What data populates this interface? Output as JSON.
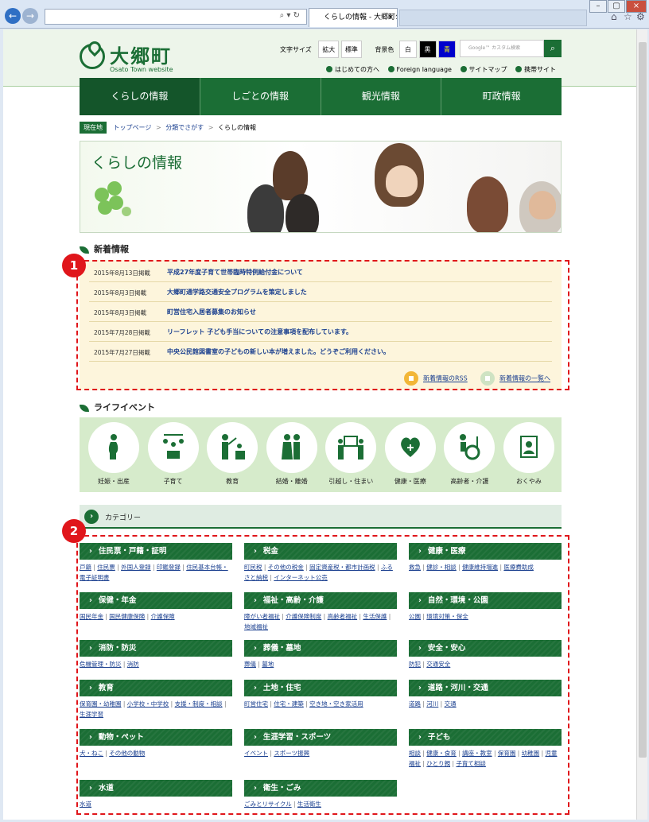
{
  "browser": {
    "tab_title": "くらしの情報 - 大郷町公...",
    "tab_close": "×",
    "back_icon": "←",
    "forward_icon": "→",
    "window_controls": [
      "–",
      "▢",
      "×"
    ]
  },
  "header": {
    "logo_title": "大郷町",
    "logo_subtitle": "Osato Town website",
    "font_size_label": "文字サイズ",
    "font_size_buttons": [
      "拡大",
      "標準"
    ],
    "bg_color_label": "背景色",
    "bg_color_buttons": [
      {
        "label": "白",
        "bg": "#ffffff",
        "fg": "#222222"
      },
      {
        "label": "黒",
        "bg": "#000000",
        "fg": "#ffffff"
      },
      {
        "label": "青",
        "bg": "#0000cc",
        "fg": "#ffff00"
      }
    ],
    "search_placeholder": "Google™ カスタム検索",
    "links": [
      "はじめての方へ",
      "Foreign language",
      "サイトマップ",
      "携帯サイト"
    ]
  },
  "global_nav": [
    "くらしの情報",
    "しごとの情報",
    "観光情報",
    "町政情報"
  ],
  "breadcrumb": {
    "tag": "現在地",
    "items": [
      "トップページ",
      "分類でさがす",
      "くらしの情報"
    ],
    "separator": ">"
  },
  "banner": {
    "title": "くらしの情報"
  },
  "news": {
    "heading": "新着情報",
    "items": [
      {
        "date": "2015年8月13日掲載",
        "title": "平成27年度子育て世帯臨時特例給付金について"
      },
      {
        "date": "2015年8月3日掲載",
        "title": "大郷町通学路交通安全プログラムを策定しました"
      },
      {
        "date": "2015年8月3日掲載",
        "title": "町営住宅入居者募集のお知らせ"
      },
      {
        "date": "2015年7月28日掲載",
        "title": "リーフレット 子ども手当についての注意事項を配布しています。"
      },
      {
        "date": "2015年7月27日掲載",
        "title": "中央公民館図書室の子どもの新しい本が増えました。どうぞご利用ください。"
      }
    ],
    "rss_link": "新着情報のRSS",
    "all_link": "新着情報の一覧へ"
  },
  "life_events": {
    "heading": "ライフイベント",
    "items": [
      "妊娠・出産",
      "子育て",
      "教育",
      "結婚・離婚",
      "引越し・住まい",
      "健康・医療",
      "高齢者・介護",
      "おくやみ"
    ]
  },
  "categories": {
    "heading": "カテゴリー",
    "groups": [
      {
        "title": "住民票・戸籍・証明",
        "links": [
          "戸籍",
          "住民票",
          "外国人登録",
          "印鑑登録",
          "住民基本台帳・電子証明書"
        ]
      },
      {
        "title": "税金",
        "links": [
          "町民税",
          "その他の税金",
          "固定資産税・都市計画税",
          "ふるさと納税",
          "インターネット公売"
        ]
      },
      {
        "title": "健康・医療",
        "links": [
          "救急",
          "健診・相談",
          "健康維持増進",
          "医療費助成"
        ]
      },
      {
        "title": "保健・年金",
        "links": [
          "国民年金",
          "国民健康保険",
          "介護保険"
        ]
      },
      {
        "title": "福祉・高齢・介護",
        "links": [
          "障がい者福祉",
          "介護保険制度",
          "高齢者福祉",
          "生活保護",
          "地域福祉"
        ]
      },
      {
        "title": "自然・環境・公園",
        "links": [
          "公園",
          "環境対策・保全"
        ]
      },
      {
        "title": "消防・防災",
        "links": [
          "危機管理・防災",
          "消防"
        ]
      },
      {
        "title": "葬儀・墓地",
        "links": [
          "葬儀",
          "墓地"
        ]
      },
      {
        "title": "安全・安心",
        "links": [
          "防犯",
          "交通安全"
        ]
      },
      {
        "title": "教育",
        "links": [
          "保育園・幼稚園",
          "小学校・中学校",
          "支援・制度・相談",
          "生涯学習"
        ]
      },
      {
        "title": "土地・住宅",
        "links": [
          "町営住宅",
          "住宅・建築",
          "空き地・空き家活用"
        ]
      },
      {
        "title": "道路・河川・交通",
        "links": [
          "道路",
          "河川",
          "交通"
        ]
      },
      {
        "title": "動物・ペット",
        "links": [
          "犬・ねこ",
          "その他の動物"
        ]
      },
      {
        "title": "生涯学習・スポーツ",
        "links": [
          "イベント",
          "スポーツ振興"
        ]
      },
      {
        "title": "子ども",
        "links": [
          "相談",
          "健康・食育",
          "講座・教室",
          "保育園",
          "幼稚園",
          "児童福祉",
          "ひとり親",
          "子育て相談"
        ]
      },
      {
        "title": "水道",
        "links": [
          "水道"
        ]
      },
      {
        "title": "衛生・ごみ",
        "links": [
          "ごみとリサイクル",
          "生活衛生"
        ]
      }
    ]
  },
  "annotations": [
    {
      "label": "1"
    },
    {
      "label": "2"
    }
  ],
  "colors": {
    "brand_green": "#1b6e35",
    "annotation_red": "#e0161b",
    "news_bg": "#fdf5dc",
    "life_bg": "#d6ebcb"
  }
}
